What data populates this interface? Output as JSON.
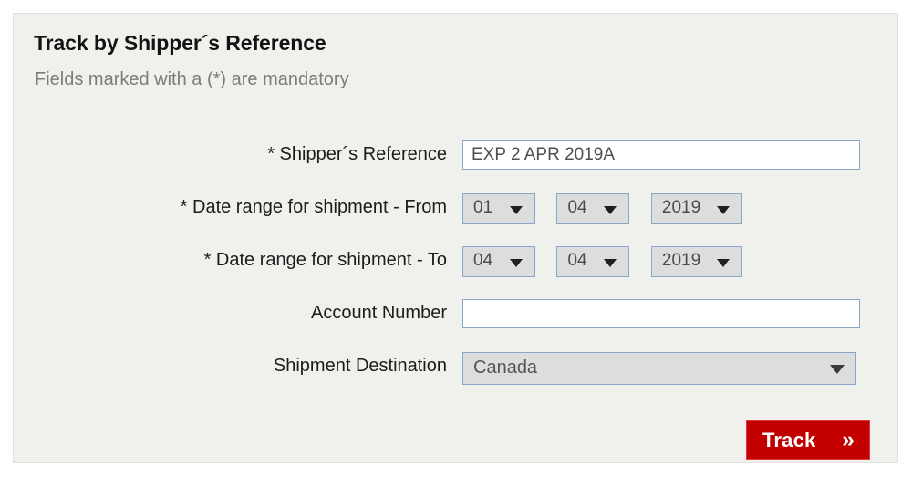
{
  "card": {
    "title": "Track by Shipper´s Reference",
    "subtitle": "Fields marked with a (*) are mandatory"
  },
  "form": {
    "shipper_reference": {
      "label": "* Shipper´s Reference",
      "value": "EXP 2 APR 2019A",
      "placeholder": ""
    },
    "date_from": {
      "label": "* Date range for shipment - From",
      "day": "01",
      "month": "04",
      "year": "2019"
    },
    "date_to": {
      "label": "* Date range for shipment - To",
      "day": "04",
      "month": "04",
      "year": "2019"
    },
    "account_number": {
      "label": "Account Number",
      "value": "",
      "placeholder": ""
    },
    "shipment_destination": {
      "label": "Shipment Destination",
      "value": "Canada"
    }
  },
  "actions": {
    "track_label": "Track",
    "track_chevron": "»"
  },
  "colors": {
    "card_background": "#f0f0ec",
    "page_background": "#ffffff",
    "accent_red": "#c20000",
    "control_border": "#89a8c8",
    "select_fill": "#dddddd",
    "muted_text": "#7c7c79"
  }
}
